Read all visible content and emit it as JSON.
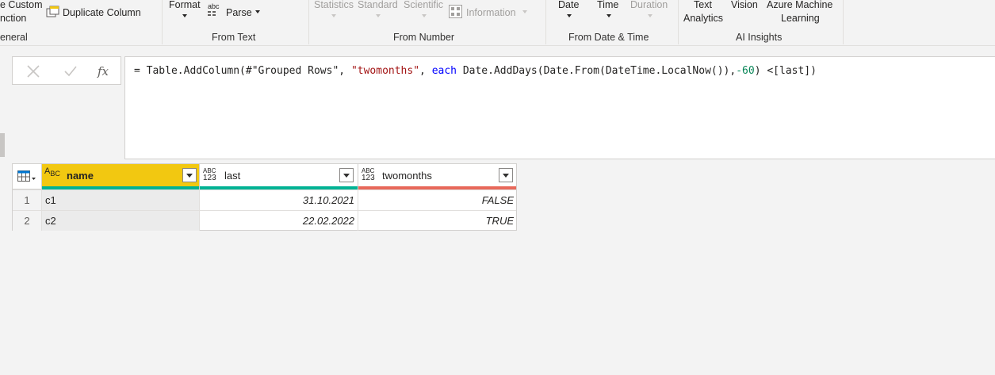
{
  "ribbon": {
    "general": {
      "custom_function_line1": "e Custom",
      "custom_function_line2": "nction",
      "duplicate_column": "Duplicate Column",
      "label": "eneral"
    },
    "from_text": {
      "format": "Format",
      "parse": "Parse",
      "parse_icon_text": "abc",
      "label": "From Text"
    },
    "from_number": {
      "statistics": "Statistics",
      "standard": "Standard",
      "scientific": "Scientific",
      "information": "Information",
      "label": "From Number"
    },
    "from_date_time": {
      "date": "Date",
      "time": "Time",
      "duration": "Duration",
      "label": "From Date & Time"
    },
    "ai_insights": {
      "text_analytics_line1": "Text",
      "text_analytics_line2": "Analytics",
      "vision": "Vision",
      "azure_ml_line1": "Azure Machine",
      "azure_ml_line2": "Learning",
      "label": "AI Insights"
    }
  },
  "formula_bar": {
    "fx_label": "fx",
    "formula": {
      "p1": "= Table.AddColumn(#\"Grouped Rows\", ",
      "p2": "\"twomonths\"",
      "p3": ", ",
      "p4": "each",
      "p5": " Date.AddDays(Date.From(DateTime.LocalNow()),",
      "p6": "-60",
      "p7": ") <[last])"
    }
  },
  "table": {
    "columns": [
      {
        "label": "name",
        "type_icon_top": "A",
        "type_icon_bottom": "BC",
        "quality_color": "#00b294"
      },
      {
        "label": "last",
        "type_icon_top": "ABC",
        "type_icon_bottom": "123",
        "quality_color": "#00b294"
      },
      {
        "label": "twomonths",
        "type_icon_top": "ABC",
        "type_icon_bottom": "123",
        "quality_color": "#e8685a"
      }
    ],
    "rows": [
      {
        "num": "1",
        "name": "c1",
        "last": "31.10.2021",
        "twomonths": "FALSE"
      },
      {
        "num": "2",
        "name": "c2",
        "last": "22.02.2022",
        "twomonths": "TRUE"
      }
    ]
  },
  "colors": {
    "selected_header": "#f2c811",
    "valid_quality": "#00b294",
    "error_quality": "#e8685a"
  }
}
